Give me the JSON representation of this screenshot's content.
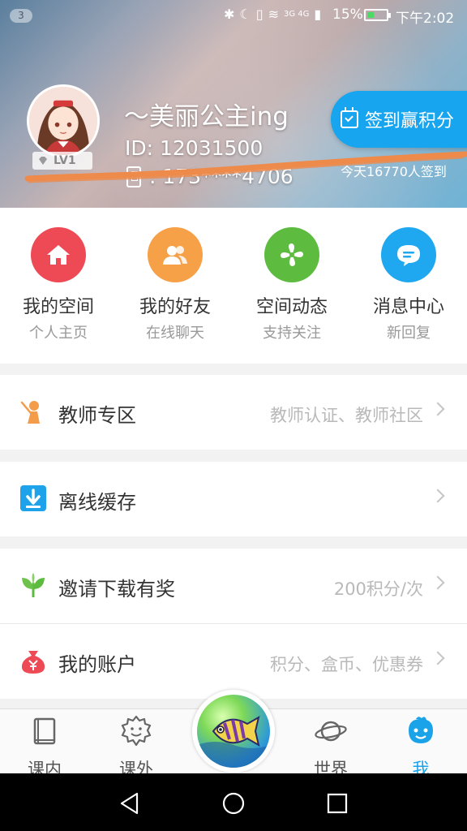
{
  "status_bar": {
    "notification_count": "3",
    "network_label": "3G 4G",
    "battery_percent": "15%",
    "time": "下午2:02"
  },
  "profile": {
    "username": "～美丽公主ing",
    "user_id": "ID: 12031500",
    "phone": ": 173****4706",
    "level": "LV1"
  },
  "signin": {
    "button_label": "签到赢积分",
    "today_count": "今天16770人签到"
  },
  "quick_actions": [
    {
      "title": "我的空间",
      "subtitle": "个人主页",
      "color": "#ee4a55"
    },
    {
      "title": "我的好友",
      "subtitle": "在线聊天",
      "color": "#f6a047"
    },
    {
      "title": "空间动态",
      "subtitle": "支持关注",
      "color": "#5dbb3f"
    },
    {
      "title": "消息中心",
      "subtitle": "新回复",
      "color": "#1fa8ef"
    }
  ],
  "rows": [
    {
      "label": "教师专区",
      "hint": "教师认证、教师社区"
    },
    {
      "label": "离线缓存",
      "hint": ""
    },
    {
      "label": "邀请下载有奖",
      "hint": "200积分/次"
    },
    {
      "label": "我的账户",
      "hint": "积分、盒币、优惠券"
    }
  ],
  "tabs": [
    {
      "label": "课内",
      "icon": "book-icon"
    },
    {
      "label": "课外",
      "icon": "smiley-gear-icon"
    },
    {
      "label": "世界",
      "icon": "planet-icon"
    },
    {
      "label": "我",
      "icon": "me-face-icon",
      "active": true
    }
  ],
  "colors": {
    "accent": "#1aa3e8",
    "signin_button": "#16a5ee"
  }
}
